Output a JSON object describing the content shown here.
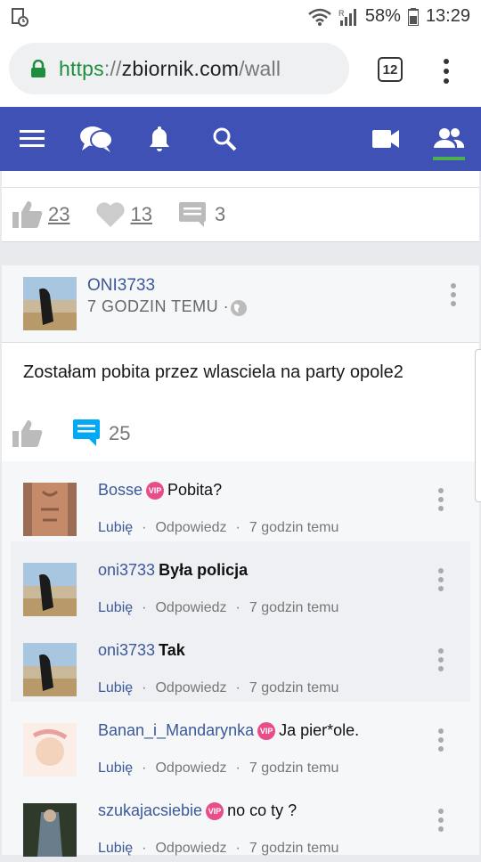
{
  "status": {
    "battery": "58%",
    "time": "13:29",
    "signal_label": "R"
  },
  "browser": {
    "url_scheme": "https",
    "url_sep": "://",
    "url_host": "zbiornik.com",
    "url_path": "/wall",
    "tab_count": "12"
  },
  "nav": {
    "icons": [
      "menu-icon",
      "chat-icon",
      "bell-icon",
      "search-icon",
      "video-icon",
      "friends-icon"
    ],
    "accent": "#3f51b5",
    "active_indicator": "#4caf50"
  },
  "prev_post": {
    "likes": "23",
    "hearts": "13",
    "comments": "3"
  },
  "post": {
    "author": "ONI3733",
    "time": "7 GODZIN TEMU ·",
    "text": "Zostałam pobita przez wlasciela na party opole2",
    "comment_count": "25"
  },
  "comments": [
    {
      "name": "Bosse",
      "vip": true,
      "text": "Pobita?",
      "bold": false,
      "like": "Lubię",
      "reply": "Odpowiedz",
      "time": "7 godzin temu"
    },
    {
      "name": "oni3733",
      "vip": false,
      "text": "Była policja",
      "bold": true,
      "like": "Lubię",
      "reply": "Odpowiedz",
      "time": "7 godzin temu"
    },
    {
      "name": "oni3733",
      "vip": false,
      "text": "Tak",
      "bold": true,
      "like": "Lubię",
      "reply": "Odpowiedz",
      "time": "7 godzin temu"
    },
    {
      "name": "Banan_i_Mandarynka",
      "vip": true,
      "text": "Ja pier*ole.",
      "bold": false,
      "like": "Lubię",
      "reply": "Odpowiedz",
      "time": "7 godzin temu"
    },
    {
      "name": "szukajacsiebie",
      "vip": true,
      "text": "no co ty ?",
      "bold": false,
      "like": "Lubię",
      "reply": "Odpowiedz",
      "time": "7 godzin temu"
    }
  ],
  "vip_label": "VIP",
  "meta_sep": "·"
}
